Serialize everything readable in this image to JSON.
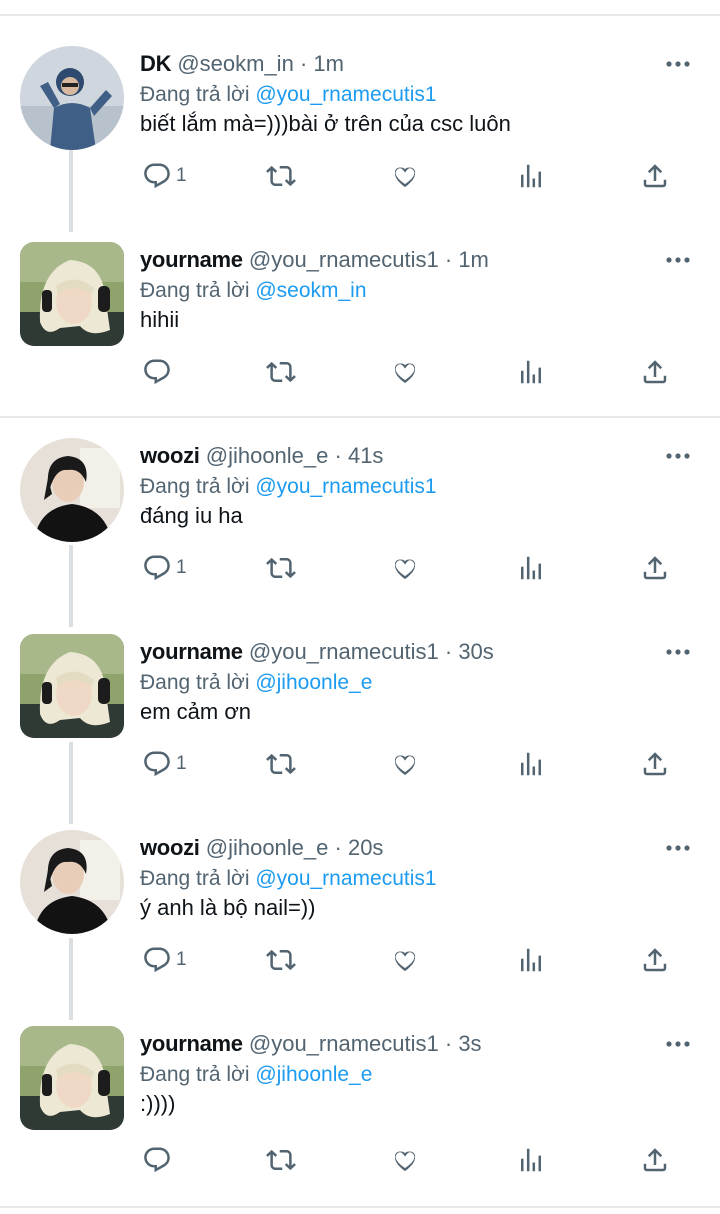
{
  "replying_prefix": "Đang trả lời",
  "tweets": [
    {
      "name": "DK",
      "handle": "@seokm_in",
      "time": "· 1m",
      "replying_to": "@you_rnamecutis1",
      "text": "biết lắm mà=)))bài ở trên của csc luôn",
      "reply_count": "1",
      "avatar": "dk-avatar"
    },
    {
      "name": "yourname",
      "handle": "@you_rnamecutis1",
      "time": "· 1m",
      "replying_to": "@seokm_in",
      "text": "hihii",
      "reply_count": "",
      "avatar": "yourname-avatar"
    },
    {
      "name": "woozi",
      "handle": "@jihoonle_e",
      "time": "· 41s",
      "replying_to": "@you_rnamecutis1",
      "text": "đáng iu ha",
      "reply_count": "1",
      "avatar": "woozi-avatar"
    },
    {
      "name": "yourname",
      "handle": "@you_rnamecutis1",
      "time": "· 30s",
      "replying_to": "@jihoonle_e",
      "text": "em cảm ơn",
      "reply_count": "1",
      "avatar": "yourname-avatar"
    },
    {
      "name": "woozi",
      "handle": "@jihoonle_e",
      "time": "· 20s",
      "replying_to": "@you_rnamecutis1",
      "text": "ý anh là bộ nail=))",
      "reply_count": "1",
      "avatar": "woozi-avatar"
    },
    {
      "name": "yourname",
      "handle": "@you_rnamecutis1",
      "time": "· 3s",
      "replying_to": "@jihoonle_e",
      "text": ":))))",
      "reply_count": "",
      "avatar": "yourname-avatar"
    }
  ],
  "icons": {
    "reply": "reply-icon",
    "retweet": "retweet-icon",
    "like": "heart-icon",
    "views": "views-icon",
    "share": "share-icon",
    "more": "more-icon"
  },
  "colors": {
    "link": "#1d9bf0",
    "secondary": "#536471",
    "text": "#0f1419",
    "divider": "#e6e9ec"
  }
}
